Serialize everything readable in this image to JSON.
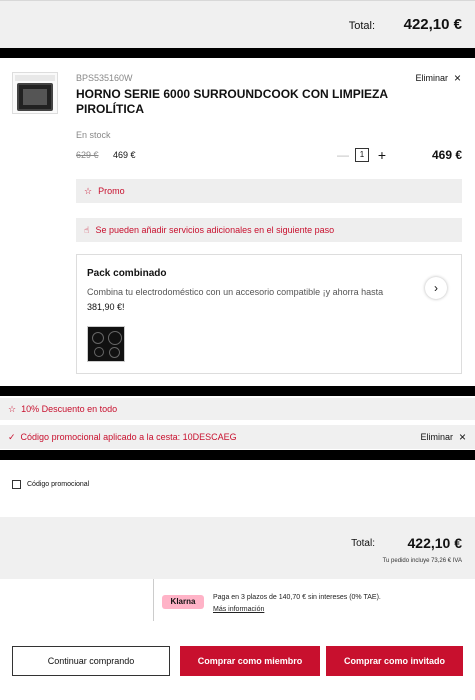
{
  "top_summary": {
    "total_label": "Total:",
    "total_amount": "422,10 €"
  },
  "product": {
    "sku": "BPS535160W",
    "name": "HORNO SERIE 6000 SURROUNDCOOK CON LIMPIEZA PIROLÍTICA",
    "remove_label": "Eliminar",
    "stock": "En stock",
    "old_price": "629 €",
    "price": "469 €",
    "quantity": "1",
    "line_total": "469 €",
    "promo_label": "Promo",
    "services_notice": "Se pueden añadir servicios adicionales en el siguiente paso"
  },
  "pack": {
    "title": "Pack combinado",
    "description": "Combina tu electrodoméstico con un accesorio compatible ¡y ahorra hasta",
    "amount": "381,90 €!"
  },
  "discounts": {
    "global_discount": "10% Descuento en todo",
    "coupon_applied": "Código promocional aplicado a la cesta: 10DESCAEG",
    "remove_label": "Eliminar"
  },
  "coupon_checkbox_label": "Código promocional",
  "summary": {
    "total_label": "Total:",
    "total_amount": "422,10 €",
    "vat_note": "Tu pedido incluye 73,26 € IVA"
  },
  "klarna": {
    "badge": "Klarna",
    "text": "Paga en 3 plazos de 140,70 € sin intereses (0% TAE).",
    "link": "Más información",
    "badge_color": "#ffb3c7"
  },
  "buttons": {
    "continue": "Continuar comprando",
    "buy_member": "Comprar como miembro",
    "buy_guest": "Comprar como invitado"
  },
  "colors": {
    "accent": "#c8102e",
    "panel": "#f0f0f0"
  }
}
